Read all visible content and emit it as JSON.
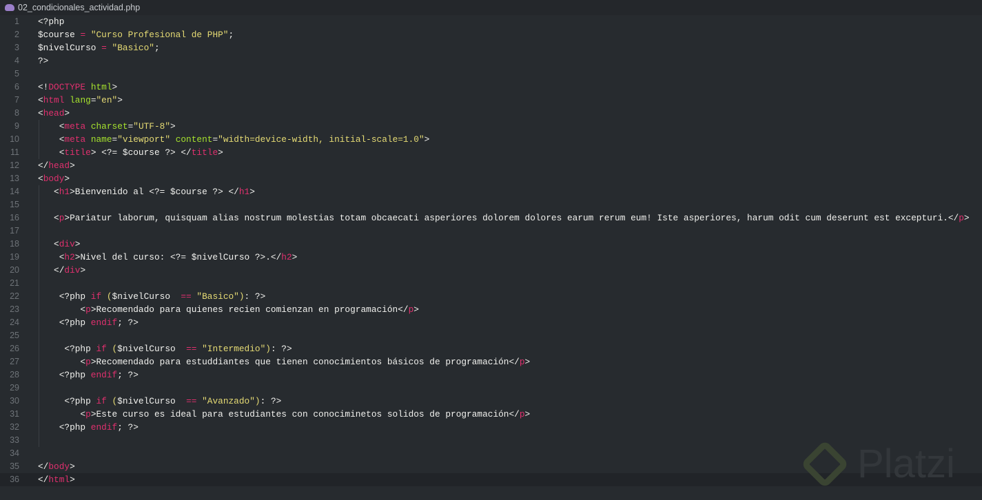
{
  "tab": {
    "title": "02_condicionales_actividad.php",
    "icon": "php-elephant-icon"
  },
  "watermark": "Platzi",
  "colors": {
    "background": "#272b2f",
    "keyword": "#e0306e",
    "string": "#e6db74",
    "attribute": "#a6e22e",
    "text": "#f1f1ee"
  },
  "current_line": 36,
  "lines": [
    [
      [
        "t",
        "<?php"
      ]
    ],
    [
      [
        "t",
        "$course "
      ],
      [
        "o",
        "="
      ],
      [
        "t",
        " "
      ],
      [
        "s",
        "\"Curso Profesional de PHP\""
      ],
      [
        "t",
        ";"
      ]
    ],
    [
      [
        "t",
        "$nivelCurso "
      ],
      [
        "o",
        "="
      ],
      [
        "t",
        " "
      ],
      [
        "s",
        "\"Basico\""
      ],
      [
        "t",
        ";"
      ]
    ],
    [
      [
        "t",
        "?>"
      ]
    ],
    [],
    [
      [
        "t",
        "<!"
      ],
      [
        "k",
        "DOCTYPE"
      ],
      [
        "t",
        " "
      ],
      [
        "a",
        "html"
      ],
      [
        "t",
        ">"
      ]
    ],
    [
      [
        "t",
        "<"
      ],
      [
        "k",
        "html"
      ],
      [
        "t",
        " "
      ],
      [
        "a",
        "lang"
      ],
      [
        "t",
        "="
      ],
      [
        "s",
        "\"en\""
      ],
      [
        "t",
        ">"
      ]
    ],
    [
      [
        "t",
        "<"
      ],
      [
        "k",
        "head"
      ],
      [
        "t",
        ">"
      ]
    ],
    [
      [
        "t",
        "    <"
      ],
      [
        "k",
        "meta"
      ],
      [
        "t",
        " "
      ],
      [
        "a",
        "charset"
      ],
      [
        "t",
        "="
      ],
      [
        "s",
        "\"UTF-8\""
      ],
      [
        "t",
        ">"
      ]
    ],
    [
      [
        "t",
        "    <"
      ],
      [
        "k",
        "meta"
      ],
      [
        "t",
        " "
      ],
      [
        "a",
        "name"
      ],
      [
        "t",
        "="
      ],
      [
        "s",
        "\"viewport\""
      ],
      [
        "t",
        " "
      ],
      [
        "a",
        "content"
      ],
      [
        "t",
        "="
      ],
      [
        "s",
        "\"width=device-width, initial-scale=1.0\""
      ],
      [
        "t",
        ">"
      ]
    ],
    [
      [
        "t",
        "    <"
      ],
      [
        "k",
        "title"
      ],
      [
        "t",
        "> <?= $course ?> </"
      ],
      [
        "k",
        "title"
      ],
      [
        "t",
        ">"
      ]
    ],
    [
      [
        "t",
        "</"
      ],
      [
        "k",
        "head"
      ],
      [
        "t",
        ">"
      ]
    ],
    [
      [
        "t",
        "<"
      ],
      [
        "k",
        "body"
      ],
      [
        "t",
        ">"
      ]
    ],
    [
      [
        "t",
        "   <"
      ],
      [
        "k",
        "h1"
      ],
      [
        "t",
        ">Bienvenido al <?= $course ?> </"
      ],
      [
        "k",
        "h1"
      ],
      [
        "t",
        ">"
      ]
    ],
    [],
    [
      [
        "t",
        "   <"
      ],
      [
        "k",
        "p"
      ],
      [
        "t",
        ">Pariatur laborum, quisquam alias nostrum molestias totam obcaecati asperiores dolorem dolores earum rerum eum! Iste asperiores, harum odit cum deserunt est excepturi.</"
      ],
      [
        "k",
        "p"
      ],
      [
        "t",
        ">"
      ]
    ],
    [],
    [
      [
        "t",
        "   <"
      ],
      [
        "k",
        "div"
      ],
      [
        "t",
        ">"
      ]
    ],
    [
      [
        "t",
        "    <"
      ],
      [
        "k",
        "h2"
      ],
      [
        "t",
        ">Nivel del curso: <?= $nivelCurso ?>.</"
      ],
      [
        "k",
        "h2"
      ],
      [
        "t",
        ">"
      ]
    ],
    [
      [
        "t",
        "   </"
      ],
      [
        "k",
        "div"
      ],
      [
        "t",
        ">"
      ]
    ],
    [],
    [
      [
        "t",
        "    <?php "
      ],
      [
        "k",
        "if"
      ],
      [
        "t",
        " "
      ],
      [
        "s",
        "("
      ],
      [
        "t",
        "$nivelCurso  "
      ],
      [
        "o",
        "=="
      ],
      [
        "t",
        " "
      ],
      [
        "s",
        "\"Basico\""
      ],
      [
        "s",
        ")"
      ],
      [
        "t",
        ": ?>"
      ]
    ],
    [
      [
        "t",
        "        <"
      ],
      [
        "k",
        "p"
      ],
      [
        "t",
        ">Recomendado para quienes recien comienzan en programación</"
      ],
      [
        "k",
        "p"
      ],
      [
        "t",
        ">"
      ]
    ],
    [
      [
        "t",
        "    <?php "
      ],
      [
        "k",
        "endif"
      ],
      [
        "t",
        "; ?>"
      ]
    ],
    [],
    [
      [
        "t",
        "     <?php "
      ],
      [
        "k",
        "if"
      ],
      [
        "t",
        " "
      ],
      [
        "s",
        "("
      ],
      [
        "t",
        "$nivelCurso  "
      ],
      [
        "o",
        "=="
      ],
      [
        "t",
        " "
      ],
      [
        "s",
        "\"Intermedio\""
      ],
      [
        "s",
        ")"
      ],
      [
        "t",
        ": ?>"
      ]
    ],
    [
      [
        "t",
        "        <"
      ],
      [
        "k",
        "p"
      ],
      [
        "t",
        ">Recomendado para estuddiantes que tienen conocimientos básicos de programación</"
      ],
      [
        "k",
        "p"
      ],
      [
        "t",
        ">"
      ]
    ],
    [
      [
        "t",
        "    <?php "
      ],
      [
        "k",
        "endif"
      ],
      [
        "t",
        "; ?>"
      ]
    ],
    [],
    [
      [
        "t",
        "     <?php "
      ],
      [
        "k",
        "if"
      ],
      [
        "t",
        " "
      ],
      [
        "s",
        "("
      ],
      [
        "t",
        "$nivelCurso  "
      ],
      [
        "o",
        "=="
      ],
      [
        "t",
        " "
      ],
      [
        "s",
        "\"Avanzado\""
      ],
      [
        "s",
        ")"
      ],
      [
        "t",
        ": ?>"
      ]
    ],
    [
      [
        "t",
        "        <"
      ],
      [
        "k",
        "p"
      ],
      [
        "t",
        ">Este curso es ideal para estudiantes con conociminetos solidos de programación</"
      ],
      [
        "k",
        "p"
      ],
      [
        "t",
        ">"
      ]
    ],
    [
      [
        "t",
        "    <?php "
      ],
      [
        "k",
        "endif"
      ],
      [
        "t",
        "; ?>"
      ]
    ],
    [],
    [],
    [
      [
        "t",
        "</"
      ],
      [
        "k",
        "body"
      ],
      [
        "t",
        ">"
      ]
    ],
    [
      [
        "t",
        "</"
      ],
      [
        "k",
        "html"
      ],
      [
        "t",
        ">"
      ]
    ]
  ]
}
